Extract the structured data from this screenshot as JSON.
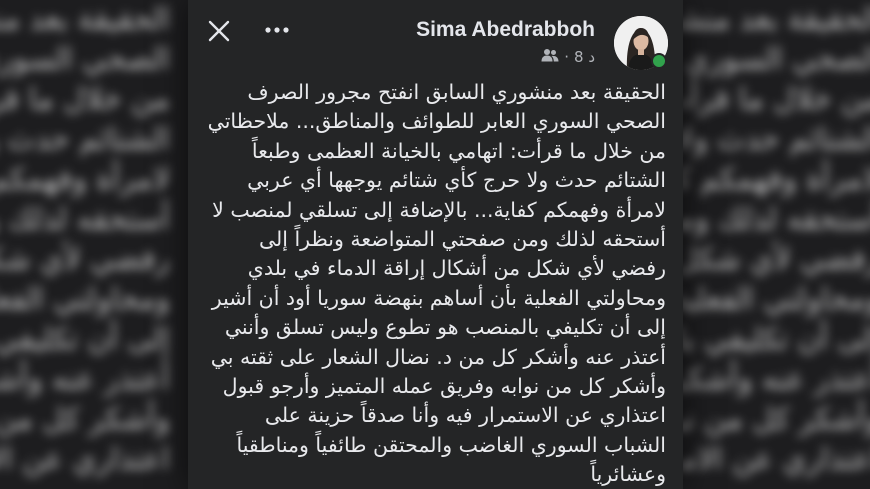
{
  "post": {
    "author_name": "Sima Abedrabboh",
    "time": "8 د",
    "separator": "·",
    "audience_icon": "friends-icon",
    "online": true,
    "close_icon": "close-icon",
    "more_icon": "more-options-icon",
    "lines": [
      "الحقيقة بعد منشوري السابق انفتح مجرور الصرف",
      "الصحي السوري العابر للطوائف والمناطق... ملاحظاتي",
      "من خلال ما قرأت: اتهامي بالخيانة العظمى وطبعاً",
      "الشتائم حدث ولا حرج كأي شتائم يوجهها أي عربي",
      "لامرأة وفهمكم كفاية... بالإضافة إلى تسلقي لمنصب لا",
      "أستحقه لذلك ومن صفحتي المتواضعة ونظراً إلى",
      "رفضي لأي شكل من أشكال إراقة الدماء في بلدي",
      "ومحاولتي الفعلية بأن أساهم بنهضة سوريا أود أن أشير",
      "إلى أن تكليفي بالمنصب هو تطوع وليس تسلق وأنني",
      "أعتذر عنه وأشكر كل من د. نضال الشعار على ثقته بي",
      "وأشكر كل من نوابه وفريق عمله المتميز وأرجو قبول",
      "اعتذاري عن الاستمرار فيه وأنا صدقاً حزينة على",
      "الشباب السوري الغاضب والمحتقن طائفياً ومناطقياً",
      "وعشائرياً"
    ]
  },
  "colors": {
    "card_bg": "#242526",
    "page_bg": "#1d1d1f",
    "text": "#e8e9ec",
    "meta_text": "#b0b3b8",
    "online": "#31a24c"
  }
}
